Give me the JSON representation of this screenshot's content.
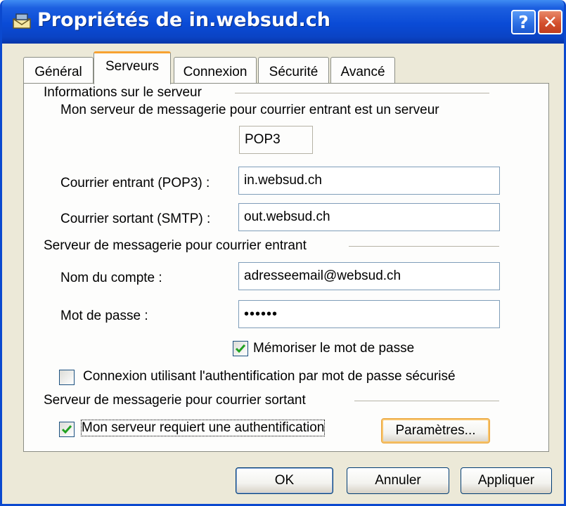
{
  "window": {
    "title": "Propriétés de in.websud.ch",
    "help_glyph": "?",
    "close_glyph": "✕",
    "icon": "mail-server-icon"
  },
  "tabs": [
    {
      "label": "Général",
      "active": false
    },
    {
      "label": "Serveurs",
      "active": true
    },
    {
      "label": "Connexion",
      "active": false
    },
    {
      "label": "Sécurité",
      "active": false
    },
    {
      "label": "Avancé",
      "active": false
    }
  ],
  "server_info": {
    "group_title": "Informations sur le serveur",
    "incoming_type_text": "Mon serveur de messagerie pour courrier entrant est un serveur",
    "incoming_type_value": "POP3",
    "incoming_label": "Courrier entrant (POP3) :",
    "incoming_value": "in.websud.ch",
    "outgoing_label": "Courrier sortant (SMTP) :",
    "outgoing_value": "out.websud.ch"
  },
  "incoming": {
    "group_title": "Serveur de messagerie pour courrier entrant",
    "account_label": "Nom du compte :",
    "account_value": "adresseemail@websud.ch",
    "password_label": "Mot de passe :",
    "password_value": "••••••",
    "remember_label": "Mémoriser le mot de passe",
    "remember_checked": true,
    "spa_label": "Connexion utilisant l'authentification par mot de passe sécurisé",
    "spa_checked": false
  },
  "outgoing": {
    "group_title": "Serveur de messagerie pour courrier sortant",
    "auth_label": "Mon serveur requiert une authentification",
    "auth_checked": true,
    "settings_button": "Paramètres..."
  },
  "footer": {
    "ok": "OK",
    "cancel": "Annuler",
    "apply": "Appliquer"
  },
  "colors": {
    "title_bar": "#0a4bd6",
    "dialog_bg": "#ece9d8",
    "panel_bg": "#fdfdfc",
    "active_tab_accent": "#f7a231",
    "checkmark": "#21a121",
    "field_border": "#7f9db9"
  }
}
